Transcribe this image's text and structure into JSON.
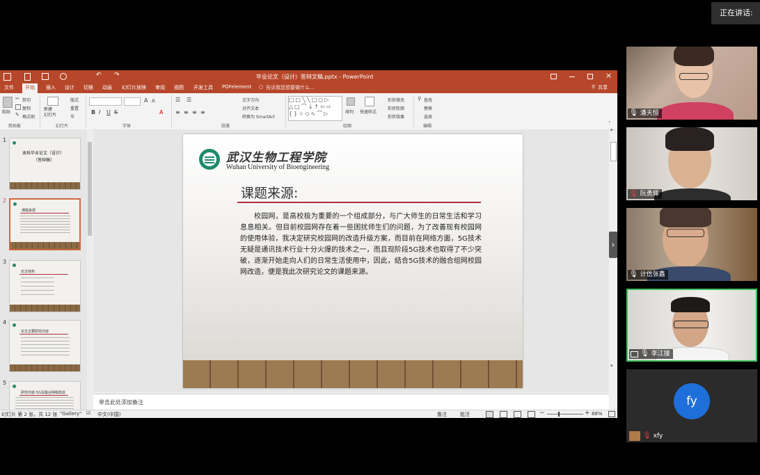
{
  "speaking_banner": "正在讲话: ",
  "window": {
    "title": "毕业论文（设计）答辩文稿.pptx - PowerPoint",
    "tabs": [
      "文件",
      "开始",
      "插入",
      "设计",
      "切换",
      "动画",
      "幻灯片放映",
      "审阅",
      "视图",
      "开发工具",
      "PDFelement"
    ],
    "tell_me": "告诉我您想要做什么...",
    "share": "共享"
  },
  "ribbon": {
    "clipboard": {
      "paste": "粘贴",
      "cut": "剪切",
      "copy": "复制",
      "format_painter": "格式刷",
      "label": "剪贴板"
    },
    "slides": {
      "new_slide": "新建\n幻灯片",
      "layout": "版式",
      "reset": "重置",
      "section": "节",
      "label": "幻灯片"
    },
    "font_label": "字体",
    "paragraph": {
      "text_direction": "文字方向",
      "align_text": "对齐文本",
      "convert_smartart": "转换为 SmartArt",
      "label": "段落"
    },
    "drawing": {
      "arrange": "排列",
      "quick_styles": "快速样式",
      "shape_fill": "形状填充",
      "shape_outline": "形状轮廓",
      "shape_effects": "形状效果",
      "label": "绘图"
    },
    "editing": {
      "find": "查找",
      "replace": "替换",
      "select": "选择",
      "label": "编辑"
    }
  },
  "thumbnails": [
    {
      "num": "1",
      "title": "本科毕业论文（设计）",
      "sub": "（答辩稿）"
    },
    {
      "num": "2",
      "title": "课题来源"
    },
    {
      "num": "3",
      "title": "论文结构"
    },
    {
      "num": "4",
      "title": "论文主要研究内容"
    },
    {
      "num": "5",
      "title": "研究内容-5G及融合网络改造"
    }
  ],
  "slide": {
    "logo_cn": "武汉生物工程学院",
    "logo_en": "Wuhan University of Bioengineering",
    "heading": "课题来源:",
    "body": "校园网，是高校极为重要的一个组成部分，与广大师生的日常生活和学习息息相关。但目前校园网存在着一些困扰师生们的问题，为了改善现有校园网的使用体验，我决定研究校园网的改造升级方案，而目前在网络方面，5G技术无疑是通讯技术行业十分火爆的技术之一，而且现阶段5G技术也取得了不少突破，逐渐开始走向人们的日常生活使用中，因此，结合5G技术的融合组网校园网改造，便是我此次研究论文的课题来源。"
  },
  "notes_placeholder": "单击此处添加备注",
  "status": {
    "slide_info": "幻灯片 第 2 张，共 12 张",
    "theme": "\"Gallery\"",
    "language": "中文(中国)",
    "notes": "备注",
    "comments": "批注",
    "zoom": "88%"
  },
  "participants": [
    {
      "name": "潘天恒",
      "muted": false,
      "bg": "#b08a80",
      "shirt": "#d04060"
    },
    {
      "name": "阮勇辉",
      "muted": true,
      "bg": "#d8d2cc",
      "shirt": "#2d2d2d"
    },
    {
      "name": "计信张鑫",
      "muted": false,
      "bg": "#9c8a78",
      "shirt": "#3a4a6a"
    },
    {
      "name": "李江接",
      "muted": false,
      "bg": "#e8e6e3",
      "shirt": "#f4f4f4",
      "active": true
    },
    {
      "name": "xfy",
      "muted": true,
      "avatar_text": "fy",
      "avatar_color": "#1e6fd9"
    }
  ],
  "colors": {
    "ppt_accent": "#b7472a",
    "active_speaker": "#3fbf5f",
    "slide_heading_rule": "#b0303a"
  }
}
